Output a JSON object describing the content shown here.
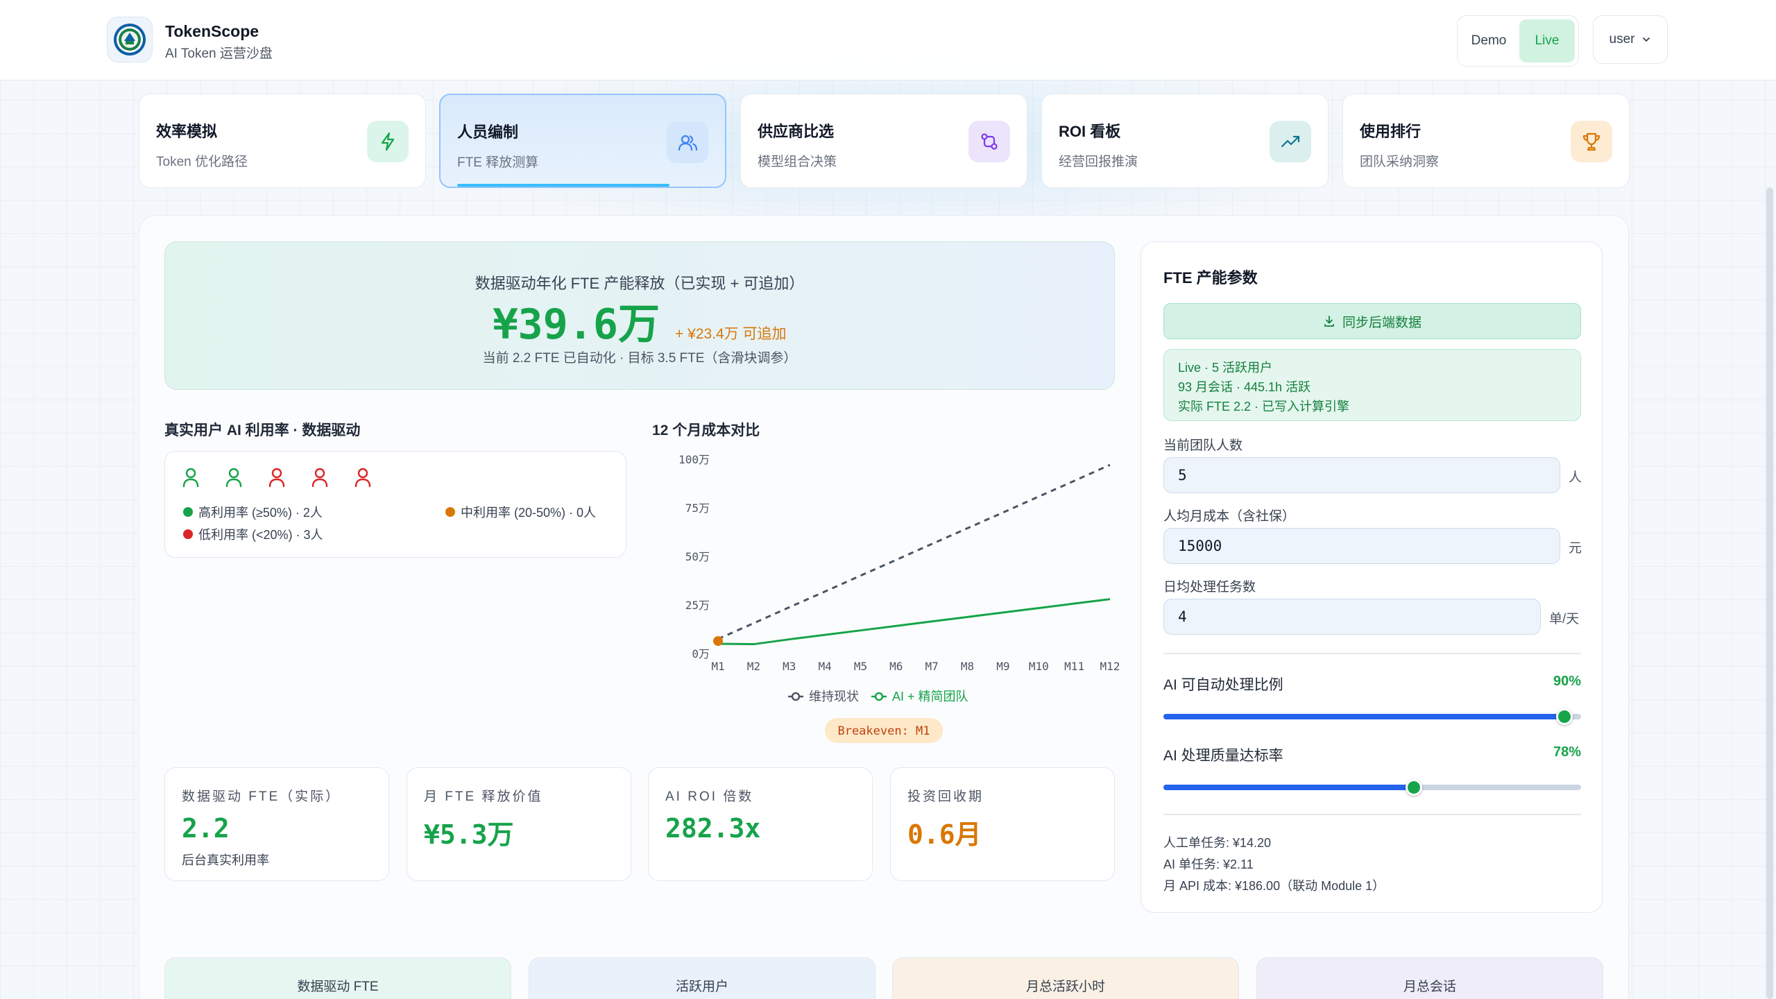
{
  "brand": {
    "title": "TokenScope",
    "subtitle": "AI Token 运营沙盘"
  },
  "mode": {
    "demo": "Demo",
    "live": "Live",
    "active": "live"
  },
  "user": {
    "name": "user"
  },
  "tabs": [
    {
      "title": "效率模拟",
      "sub": "Token 优化路径",
      "icon": "lightning-icon",
      "color": "#16a34a",
      "bg": "#dcf5ea"
    },
    {
      "title": "人员编制",
      "sub": "FTE 释放测算",
      "icon": "users-icon",
      "color": "#3b82f6",
      "bg": "#d3e6fb"
    },
    {
      "title": "供应商比选",
      "sub": "模型组合决策",
      "icon": "git-compare-icon",
      "color": "#7c3aed",
      "bg": "#ebe4fb"
    },
    {
      "title": "ROI 看板",
      "sub": "经营回报推演",
      "icon": "trend-up-icon",
      "color": "#0e7490",
      "bg": "#dcefef"
    },
    {
      "title": "使用排行",
      "sub": "团队采纳洞察",
      "icon": "trophy-icon",
      "color": "#d97706",
      "bg": "#fdecd3"
    }
  ],
  "hero": {
    "caption": "数据驱动年化 FTE 产能释放（已实现 + 可追加）",
    "value": "¥39.6万",
    "extra": "+ ¥23.4万 可追加",
    "note": "当前 2.2 FTE 已自动化 · 目标 3.5 FTE（含滑块调参）"
  },
  "utilization": {
    "title": "真实用户 AI 利用率 · 数据驱动",
    "people": [
      "#16a34a",
      "#16a34a",
      "#dc2626",
      "#dc2626",
      "#dc2626"
    ],
    "legend_high": "高利用率 (≥50%) · 2人",
    "legend_mid": "中利用率 (20-50%) · 0人",
    "legend_low": "低利用率 (<20%) · 3人",
    "colors": {
      "high": "#16a34a",
      "mid": "#d97706",
      "low": "#dc2626"
    }
  },
  "chart_data": {
    "type": "line",
    "title": "12 个月成本对比",
    "categories": [
      "M1",
      "M2",
      "M3",
      "M4",
      "M5",
      "M6",
      "M7",
      "M8",
      "M9",
      "M10",
      "M11",
      "M12"
    ],
    "y_ticks": [
      "0万",
      "25万",
      "50万",
      "75万",
      "100万"
    ],
    "ylim": [
      0,
      100
    ],
    "series": [
      {
        "name": "维持现状",
        "color": "#4b5563",
        "dashed": true,
        "values": [
          7.5,
          15.6,
          23.8,
          31.9,
          40.1,
          48.2,
          56.4,
          64.5,
          72.6,
          80.8,
          88.9,
          97.1
        ]
      },
      {
        "name": "AI + 精简团队",
        "color": "#16a34a",
        "dashed": false,
        "values": [
          5.0,
          4.8,
          7.3,
          9.6,
          11.9,
          14.2,
          16.5,
          18.8,
          21.1,
          23.4,
          25.7,
          28.0
        ]
      }
    ],
    "breakeven_label": "Breakeven: M1",
    "breakeven_color": "#d97706"
  },
  "metrics": [
    {
      "label": "数据驱动 FTE（实际）",
      "value": "2.2",
      "sub": "后台真实利用率",
      "color": "#16a34a"
    },
    {
      "label": "月 FTE 释放价值",
      "value": "¥5.3万",
      "sub": "",
      "color": "#16a34a"
    },
    {
      "label": "AI ROI 倍数",
      "value": "282.3x",
      "sub": "",
      "color": "#16a34a"
    },
    {
      "label": "投资回收期",
      "value": "0.6月",
      "sub": "",
      "color": "#d97706"
    }
  ],
  "params": {
    "title": "FTE 产能参数",
    "sync_label": "同步后端数据",
    "live_lines": [
      "Live · 5 活跃用户",
      "93 月会话 · 445.1h 活跃",
      "实际 FTE 2.2 · 已写入计算引擎"
    ],
    "team_size_label": "当前团队人数",
    "team_size_value": "5",
    "team_size_unit": "人",
    "salary_label": "人均月成本（含社保）",
    "salary_value": "15000",
    "salary_unit": "元",
    "tasks_label": "日均处理任务数",
    "tasks_value": "4",
    "tasks_unit": "单/天",
    "auto_ratio_label": "AI 可自动处理比例",
    "auto_ratio_value": "90%",
    "auto_ratio": 0.96,
    "quality_label": "AI 处理质量达标率",
    "quality_value": "78%",
    "quality": 0.6,
    "cost_human": "人工单任务: ¥14.20",
    "cost_ai": "AI 单任务: ¥2.11",
    "cost_api": "月 API 成本: ¥186.00（联动 Module 1）"
  },
  "stats": [
    {
      "label": "数据驱动 FTE",
      "bg": "#e6f6f0"
    },
    {
      "label": "活跃用户",
      "bg": "#e9f1fb"
    },
    {
      "label": "月总活跃小时",
      "bg": "#faf1e4"
    },
    {
      "label": "月总会话",
      "bg": "#efedf9"
    }
  ]
}
